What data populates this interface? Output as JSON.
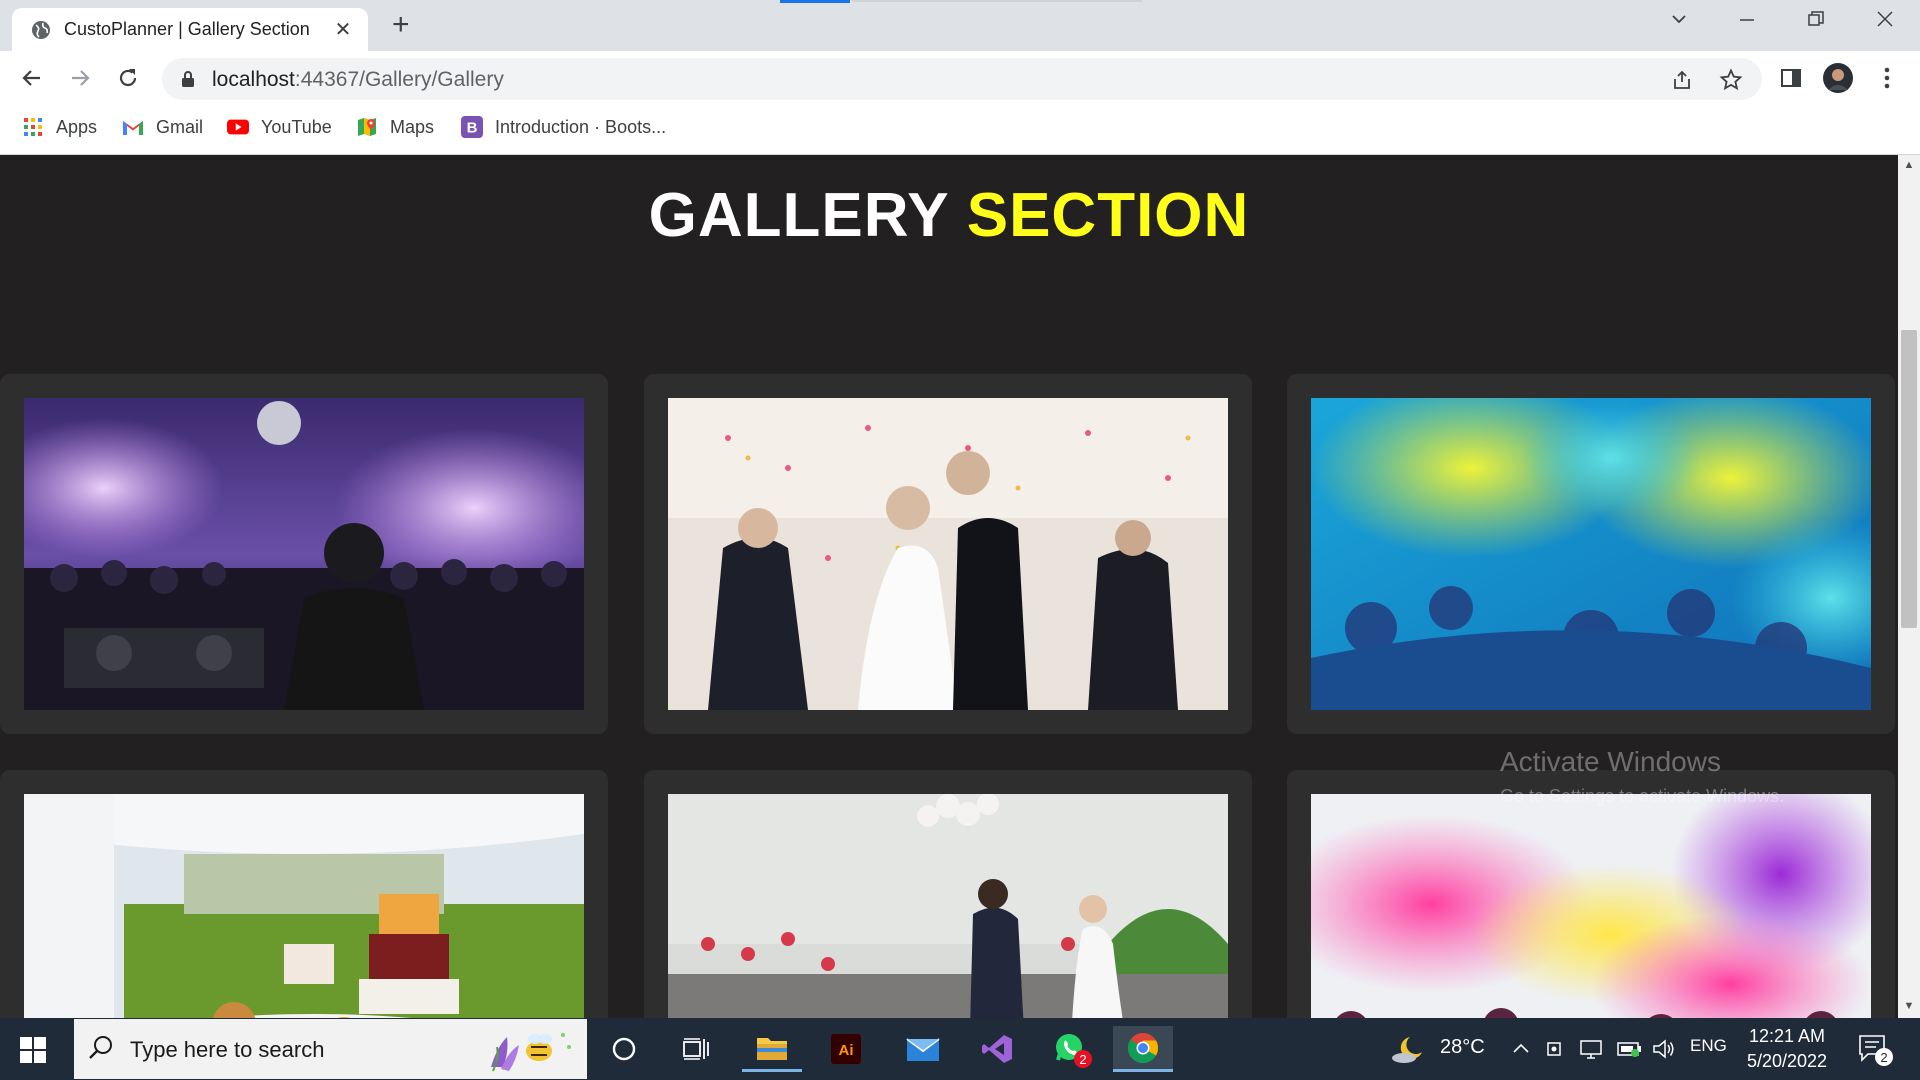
{
  "browser": {
    "tab_title": "CustoPlanner | Gallery Section",
    "tab_close": "✕",
    "new_tab": "+",
    "url_host": "localhost",
    "url_rest": ":44367/Gallery/Gallery",
    "bookmarks": [
      {
        "label": "Apps",
        "icon": "apps-grid-icon"
      },
      {
        "label": "Gmail",
        "icon": "gmail-icon"
      },
      {
        "label": "YouTube",
        "icon": "youtube-icon"
      },
      {
        "label": "Maps",
        "icon": "maps-icon"
      },
      {
        "label": "Introduction · Boots...",
        "icon": "bootstrap-icon"
      }
    ]
  },
  "page": {
    "heading_main": "GALLERY",
    "heading_accent": "SECTION",
    "accent_color": "#ffff1a",
    "gallery": [
      {
        "subject": "DJ at a nightclub party with lights and fog"
      },
      {
        "subject": "Wedding couple kissing under falling confetti"
      },
      {
        "subject": "Crowd covered in colored powder (holi)"
      },
      {
        "subject": "Outdoor dessert table with tiered cakes"
      },
      {
        "subject": "Couple releasing balloons at wedding"
      },
      {
        "subject": "Festival crowd with pink and purple color powder"
      }
    ],
    "watermark_title": "Activate Windows",
    "watermark_sub": "Go to Settings to activate Windows."
  },
  "taskbar": {
    "search_placeholder": "Type here to search",
    "temperature": "28°C",
    "language": "ENG",
    "time": "12:21 AM",
    "date": "5/20/2022",
    "whatsapp_badge": "2",
    "notification_count": "2"
  }
}
